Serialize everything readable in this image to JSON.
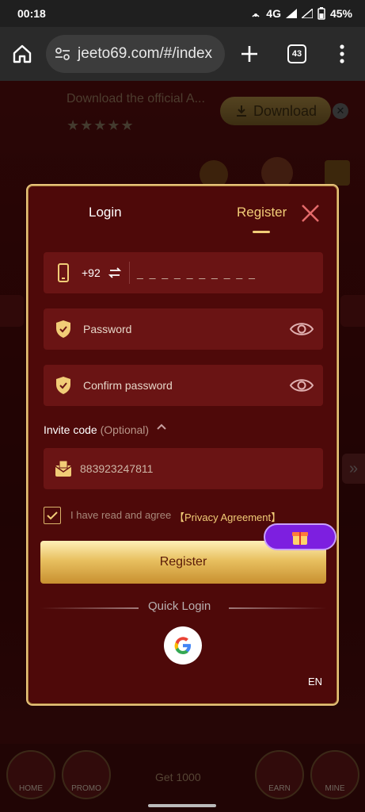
{
  "status_bar": {
    "time": "00:18",
    "network": "4G",
    "battery": "45%"
  },
  "browser": {
    "url": "jeeto69.com/#/index",
    "tab_count": "43"
  },
  "download_banner": {
    "text": "Download the official A...",
    "stars": "★★★★★",
    "button_label": "Download",
    "close_label": "✕"
  },
  "bottom_nav": {
    "home": "HOME",
    "promo": "PROMO",
    "earn": "EARN",
    "mine": "MINE",
    "center": "Get 1000"
  },
  "modal": {
    "tab_login": "Login",
    "tab_register": "Register",
    "phone": {
      "country_code": "+92",
      "placeholder": "_ _ _ _ _ _ _ _ _ _"
    },
    "password_placeholder": "Password",
    "confirm_password_placeholder": "Confirm password",
    "invite": {
      "label": "Invite code",
      "optional": "(Optional)",
      "value": "883923247811"
    },
    "agreement": {
      "text": "I have read and agree",
      "link": "【Privacy Agreement】",
      "checked": true
    },
    "register_button": "Register",
    "quick_login": "Quick Login",
    "language": "EN"
  },
  "colors": {
    "accent_gold": "#f1cc77",
    "modal_bg": "#4e0909",
    "field_bg": "#6a1414",
    "bubble_purple": "#7d1fe0"
  }
}
